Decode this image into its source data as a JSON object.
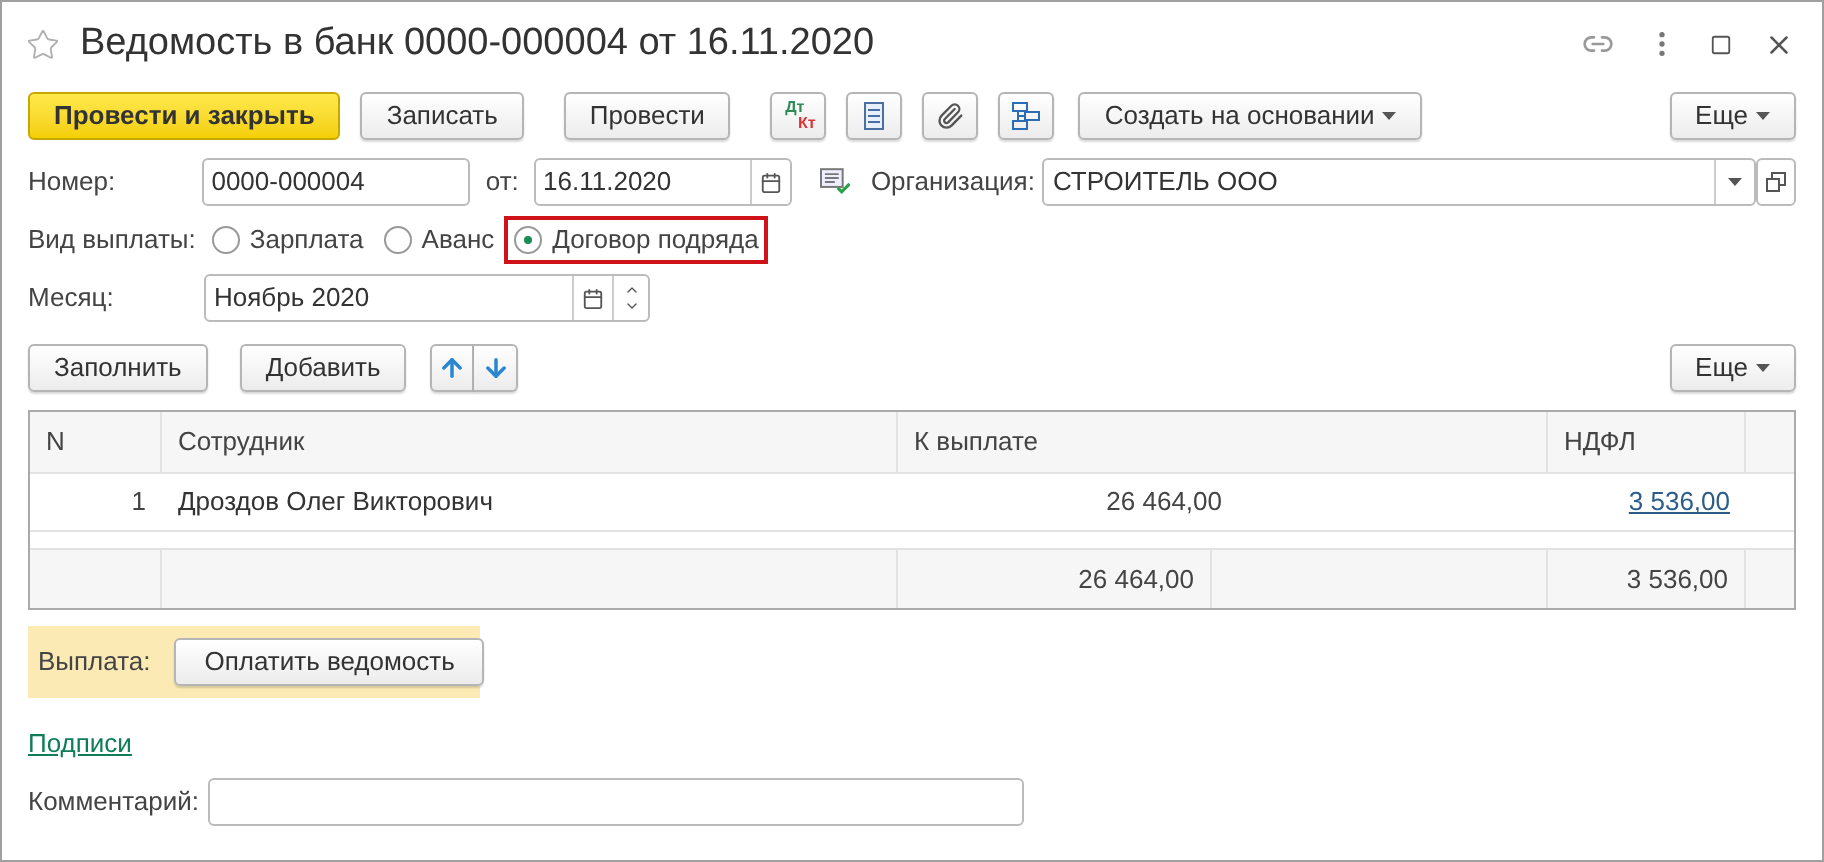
{
  "window": {
    "title": "Ведомость в банк 0000-000004 от 16.11.2020"
  },
  "toolbar": {
    "buttons": [
      {
        "kind": "primary",
        "label": "Провести и закрыть"
      },
      {
        "kind": "plain",
        "label": "Записать"
      },
      {
        "kind": "plain",
        "label": "Провести"
      },
      {
        "kind": "dtkt",
        "label": "Дт",
        "label2": "Кт"
      },
      {
        "kind": "list"
      },
      {
        "kind": "clip"
      },
      {
        "kind": "structure"
      },
      {
        "kind": "dropdown",
        "label": "Создать на основании"
      }
    ],
    "more": "Еще"
  },
  "number": {
    "label": "Номер:",
    "value": "0000-000004"
  },
  "date": {
    "label": "от:",
    "value": "16.11.2020"
  },
  "organization": {
    "label": "Организация:",
    "value": "СТРОИТЕЛЬ ООО"
  },
  "payment_type": {
    "label": "Вид выплаты:",
    "options": [
      {
        "label": "Зарплата",
        "selected": false,
        "highlighted": false
      },
      {
        "label": "Аванс",
        "selected": false,
        "highlighted": false
      },
      {
        "label": "Договор подряда",
        "selected": true,
        "highlighted": true
      }
    ]
  },
  "month": {
    "label": "Месяц:",
    "value": "Ноябрь 2020"
  },
  "table_toolbar": {
    "buttons": [
      "Заполнить",
      "Добавить"
    ],
    "more": "Еще"
  },
  "table": {
    "columns": [
      "N",
      "Сотрудник",
      "К выплате",
      "НДФЛ"
    ],
    "rows": [
      {
        "n": "1",
        "employee": "Дроздов Олег Викторович",
        "amount": "26 464,00",
        "ndfl": "3 536,00"
      }
    ],
    "totals": {
      "amount": "26 464,00",
      "ndfl": "3 536,00"
    }
  },
  "payment": {
    "label": "Выплата:",
    "button": "Оплатить ведомость"
  },
  "signatures_link": "Подписи",
  "comment": {
    "label": "Комментарий:"
  }
}
